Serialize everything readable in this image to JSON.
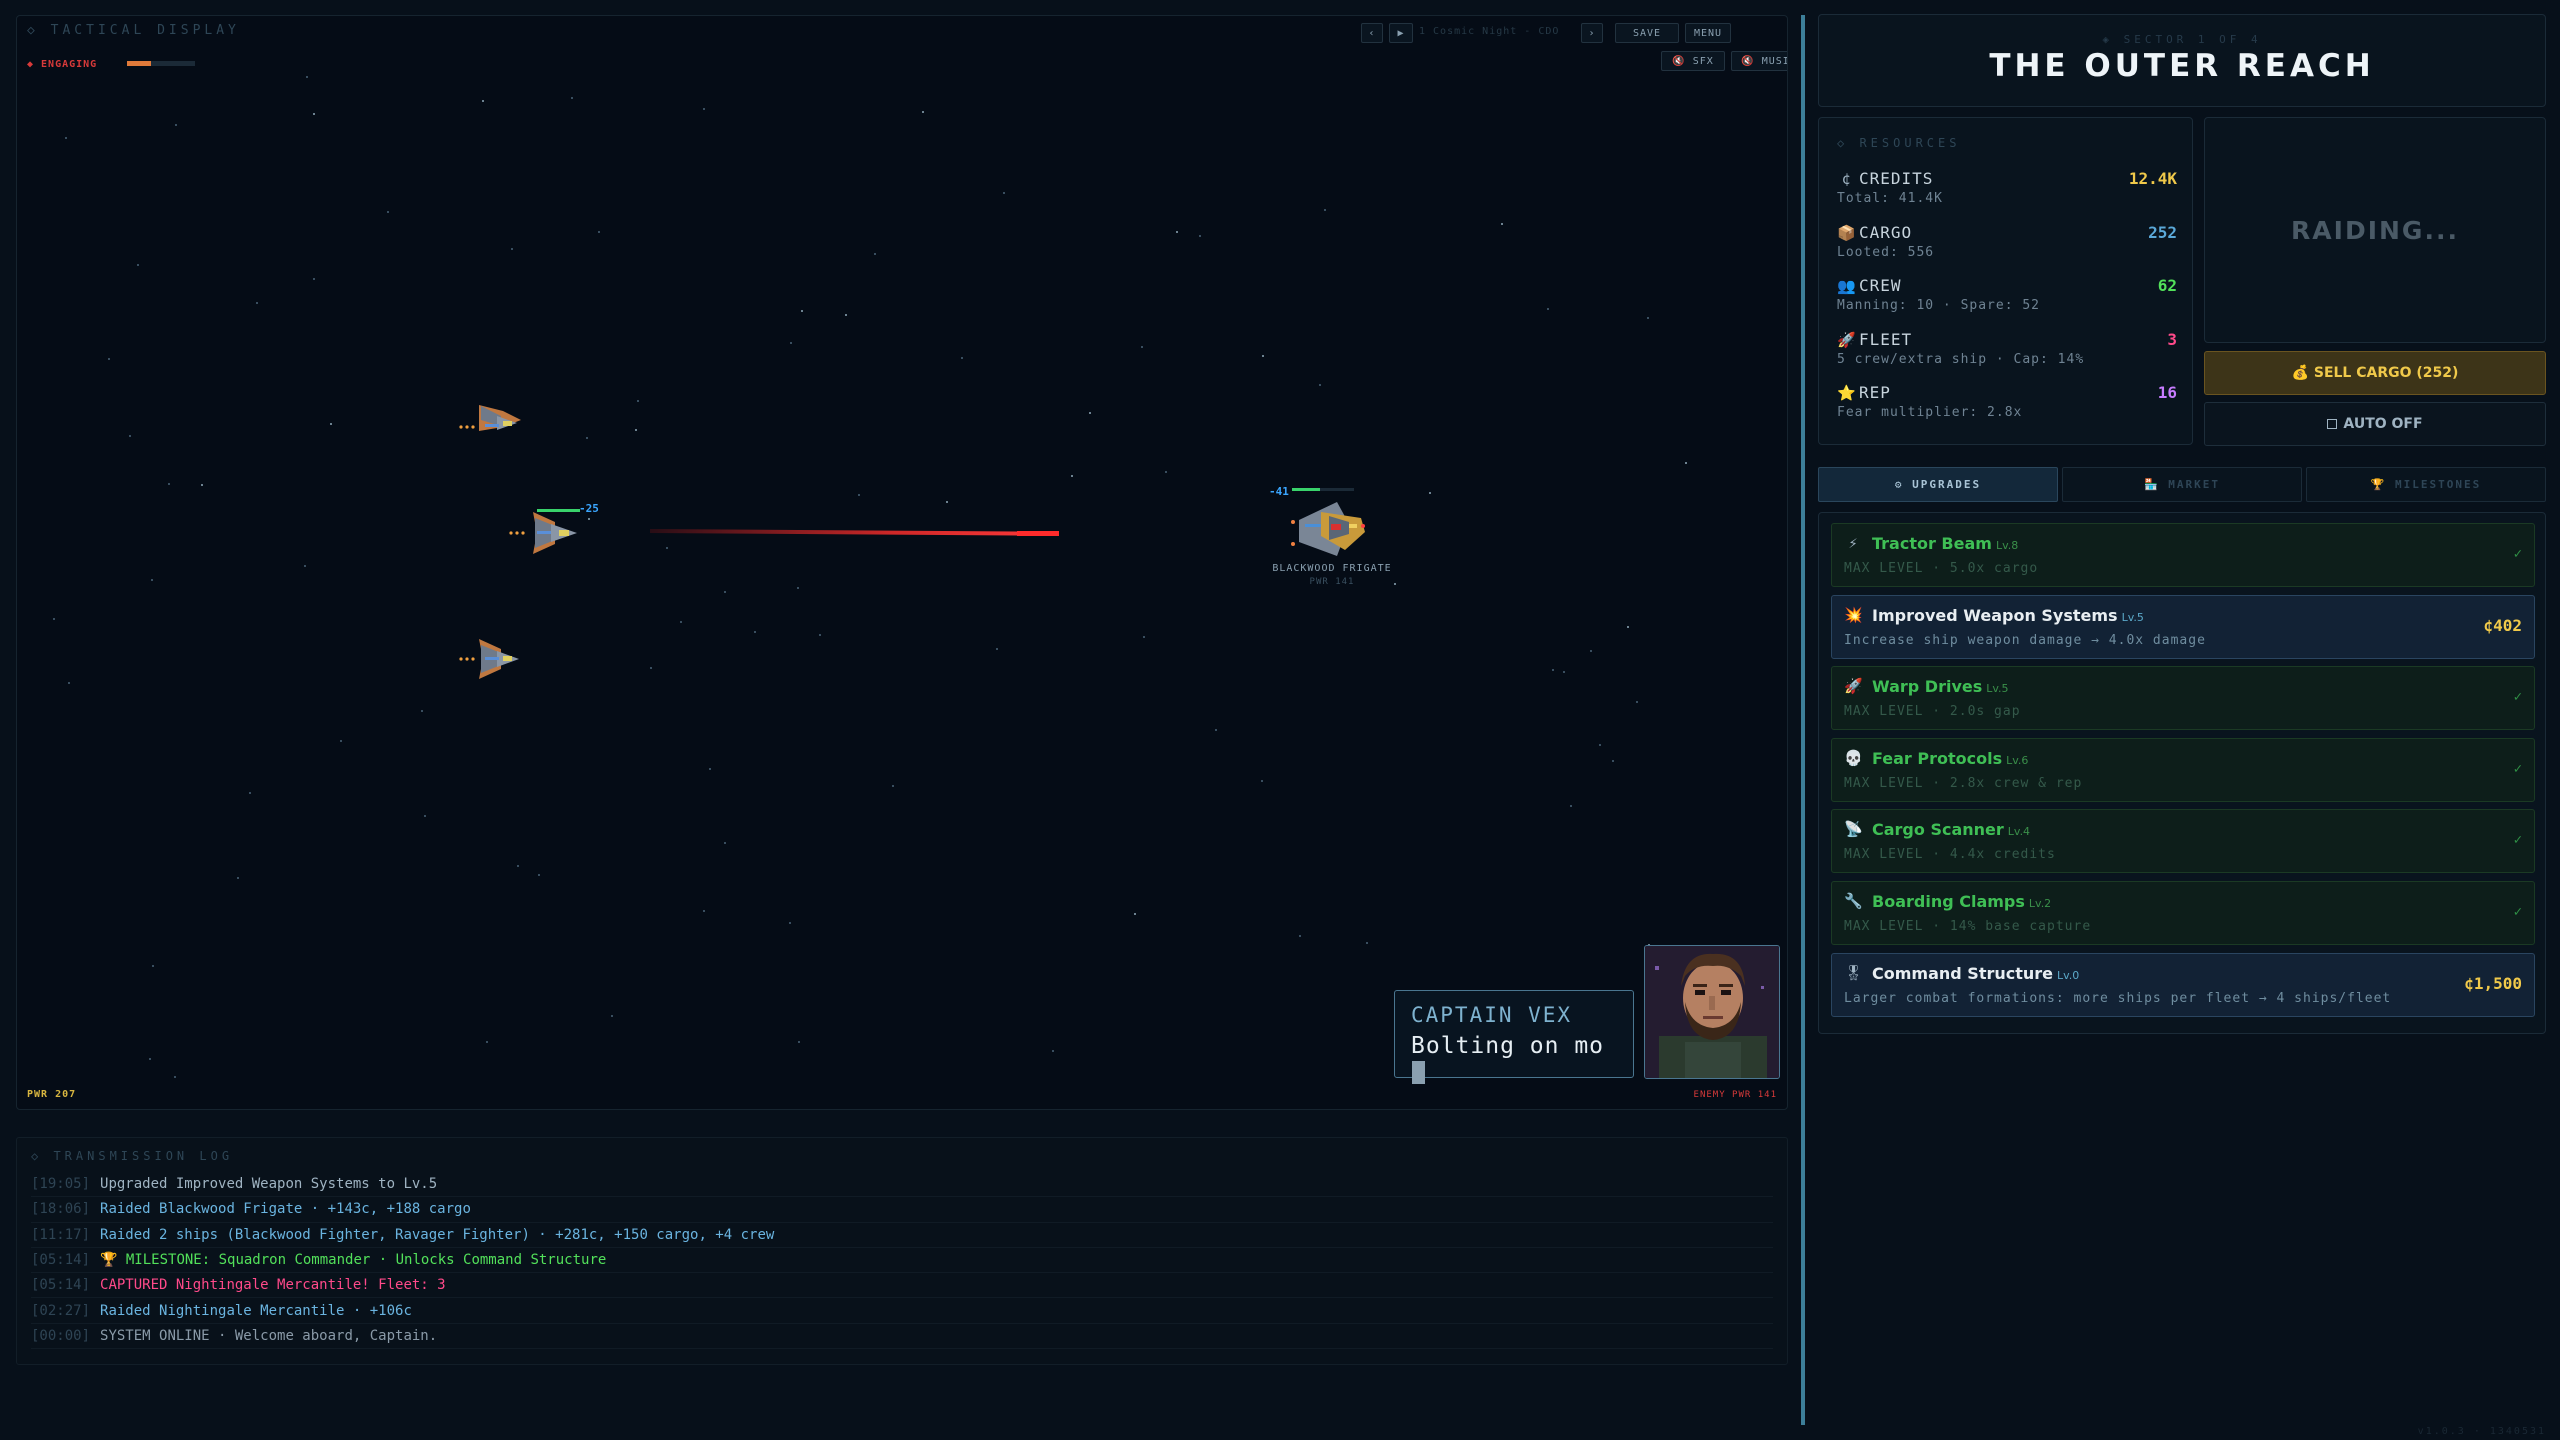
{
  "tactical": {
    "title": "◇ TACTICAL DISPLAY",
    "status": "◆ ENGAGING",
    "engage_progress": 0.35,
    "controls": {
      "prev": "‹",
      "play": "▶",
      "track": "1 Cosmic Night - CDO",
      "next": "›",
      "save": "SAVE",
      "menu": "MENU",
      "sfx": "SFX",
      "music": "MUSIC"
    },
    "player_pwr": "PWR 207",
    "enemy_pwr_corner": "ENEMY PWR 141",
    "enemy": {
      "name": "BLACKWOOD FRIGATE",
      "pwr": "PWR 141",
      "damage": "-41",
      "health": 0.45
    },
    "player_ship_damage": "-25",
    "player_ship_health": 0.85
  },
  "dialog": {
    "speaker": "CAPTAIN VEX",
    "text": "Bolting on mo"
  },
  "log": {
    "title": "◇ TRANSMISSION LOG",
    "entries": [
      {
        "time": "[19:05]",
        "text": "Upgraded Improved Weapon Systems to Lv.5",
        "color": "white"
      },
      {
        "time": "[18:06]",
        "text": "Raided Blackwood Frigate · +143c, +188 cargo",
        "color": "blue"
      },
      {
        "time": "[11:17]",
        "text": "Raided 2 ships (Blackwood Fighter, Ravager Fighter) · +281c, +150 cargo, +4 crew",
        "color": "blue"
      },
      {
        "time": "[05:14]",
        "text": "🏆 MILESTONE: Squadron Commander · Unlocks Command Structure",
        "color": "green"
      },
      {
        "time": "[05:14]",
        "text": "CAPTURED Nightingale Mercantile! Fleet: 3",
        "color": "pink"
      },
      {
        "time": "[02:27]",
        "text": "Raided Nightingale Mercantile · +106c",
        "color": "blue"
      },
      {
        "time": "[00:00]",
        "text": "SYSTEM ONLINE · Welcome aboard, Captain.",
        "color": "grey"
      }
    ]
  },
  "sector": {
    "subtitle": "◈ SECTOR 1 OF 4",
    "title": "THE OUTER REACH"
  },
  "resources": {
    "title": "◇ RESOURCES",
    "items": [
      {
        "icon": "¢",
        "name": "CREDITS",
        "sub": "Total: 41.4K",
        "value": "12.4K",
        "color": "#f0c94a"
      },
      {
        "icon": "📦",
        "name": "CARGO",
        "sub": "Looted: 556",
        "value": "252",
        "color": "#5aa8d8"
      },
      {
        "icon": "👥",
        "name": "CREW",
        "sub": "Manning: 10 · Spare: 52",
        "value": "62",
        "color": "#52e05a"
      },
      {
        "icon": "🚀",
        "name": "FLEET",
        "sub": "5 crew/extra ship · Cap: 14%",
        "value": "3",
        "color": "#ff4a8a"
      },
      {
        "icon": "⭐",
        "name": "REP",
        "sub": "Fear multiplier: 2.8x",
        "value": "16",
        "color": "#c77cff"
      }
    ]
  },
  "raid_status": "RAIDING...",
  "sell_button": "💰 SELL CARGO (252)",
  "auto_button": "AUTO OFF",
  "tabs": [
    {
      "label": "⚙ UPGRADES",
      "active": true
    },
    {
      "label": "🏪 MARKET",
      "active": false
    },
    {
      "label": "🏆 MILESTONES",
      "active": false
    }
  ],
  "upgrades": [
    {
      "icon": "⚡",
      "name": "Tractor Beam",
      "level": "Lv.8",
      "desc": "MAX LEVEL · 5.0x cargo",
      "state": "maxed",
      "cost": "✓"
    },
    {
      "icon": "💥",
      "name": "Improved Weapon Systems",
      "level": "Lv.5",
      "desc": "Increase ship weapon damage → 4.0x damage",
      "state": "avail",
      "cost": "¢402"
    },
    {
      "icon": "🚀",
      "name": "Warp Drives",
      "level": "Lv.5",
      "desc": "MAX LEVEL · 2.0s gap",
      "state": "maxed",
      "cost": "✓"
    },
    {
      "icon": "💀",
      "name": "Fear Protocols",
      "level": "Lv.6",
      "desc": "MAX LEVEL · 2.8x crew & rep",
      "state": "maxed",
      "cost": "✓"
    },
    {
      "icon": "📡",
      "name": "Cargo Scanner",
      "level": "Lv.4",
      "desc": "MAX LEVEL · 4.4x credits",
      "state": "maxed",
      "cost": "✓"
    },
    {
      "icon": "🔧",
      "name": "Boarding Clamps",
      "level": "Lv.2",
      "desc": "MAX LEVEL · 14% base capture",
      "state": "maxed",
      "cost": "✓"
    },
    {
      "icon": "🎖",
      "name": "Command Structure",
      "level": "Lv.0",
      "desc": "Larger combat formations: more ships per fleet → 4 ships/fleet",
      "state": "avail",
      "cost": "¢1,500"
    }
  ],
  "version": "v1.0.3 · 1340531"
}
